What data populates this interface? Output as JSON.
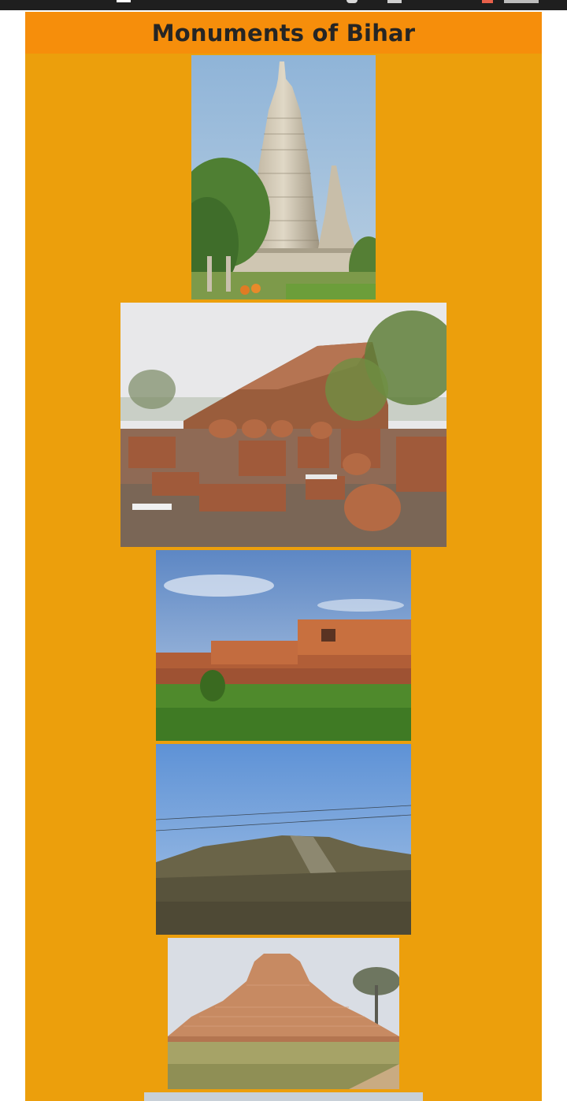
{
  "header": {
    "title": "Monuments of Bihar"
  },
  "colors": {
    "page_background": "#ec9f0c",
    "header_background": "#f68e0b",
    "title_text": "#252525",
    "status_bar": "#1f1f1f"
  },
  "gallery": [
    {
      "name": "mahabodhi-temple-photo",
      "subject": "temple-tower"
    },
    {
      "name": "stupa-ruins-photo",
      "subject": "brick-ruins"
    },
    {
      "name": "nalanda-ruins-photo",
      "subject": "brick-ruins-grass"
    },
    {
      "name": "rubble-mound-photo",
      "subject": "stone-mound"
    },
    {
      "name": "kesariya-stupa-photo",
      "subject": "terraced-stupa"
    },
    {
      "name": "partial-photo",
      "subject": "sky"
    }
  ]
}
